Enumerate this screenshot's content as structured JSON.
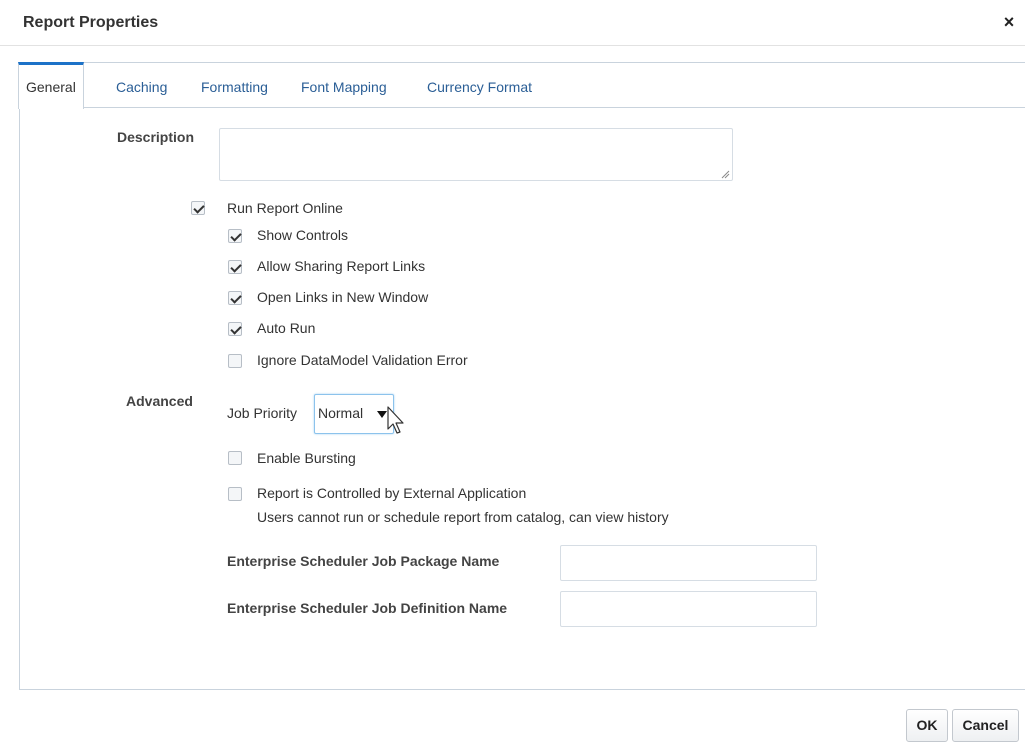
{
  "dialog": {
    "title": "Report Properties",
    "close_glyph": "×"
  },
  "tabs": [
    {
      "label": "General",
      "active": true
    },
    {
      "label": "Caching",
      "active": false
    },
    {
      "label": "Formatting",
      "active": false
    },
    {
      "label": "Font Mapping",
      "active": false
    },
    {
      "label": "Currency Format",
      "active": false
    }
  ],
  "general": {
    "description_label": "Description",
    "description_value": "",
    "run_online": {
      "label": "Run Report Online",
      "checked": true
    },
    "options": [
      {
        "label": "Show Controls",
        "checked": true
      },
      {
        "label": "Allow Sharing Report Links",
        "checked": true
      },
      {
        "label": "Open Links in New Window",
        "checked": true
      },
      {
        "label": "Auto Run",
        "checked": true
      },
      {
        "label": "Ignore DataModel Validation Error",
        "checked": false
      }
    ],
    "advanced_label": "Advanced",
    "job_priority": {
      "label": "Job Priority",
      "value": "Normal"
    },
    "enable_bursting": {
      "label": "Enable Bursting",
      "checked": false
    },
    "external_app": {
      "label": "Report is Controlled by External Application",
      "note": "Users cannot run or schedule report from catalog, can view history",
      "checked": false
    },
    "ess_package_label": "Enterprise Scheduler Job Package Name",
    "ess_package_value": "",
    "ess_definition_label": "Enterprise Scheduler Job Definition Name",
    "ess_definition_value": ""
  },
  "footer": {
    "ok_label": "OK",
    "cancel_label": "Cancel"
  },
  "colors": {
    "tab_link": "#2a5e96",
    "active_tab_border": "#1c72c8",
    "focus_border": "#8cc3ec"
  }
}
